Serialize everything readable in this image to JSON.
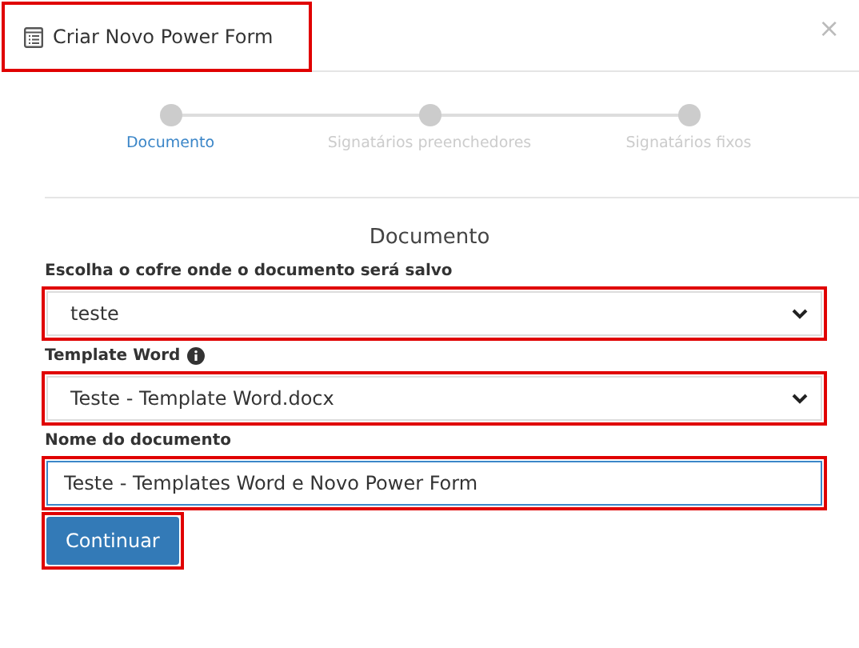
{
  "dialog": {
    "title": "Criar Novo Power Form",
    "title_highlighted": true,
    "close": "×"
  },
  "steps": [
    {
      "label": "Documento",
      "selected": true
    },
    {
      "label": "Signatários preenchedores",
      "selected": false
    },
    {
      "label": "Signatários fixos",
      "selected": false
    }
  ],
  "section_title": "Documento",
  "fields": [
    {
      "kind": "select",
      "label": "Escolha o cofre onde o documento será salvo",
      "info": false,
      "value": "teste",
      "highlighted": true
    },
    {
      "kind": "select",
      "label": "Template Word",
      "info": true,
      "value": "Teste - Template Word.docx",
      "highlighted": true
    },
    {
      "kind": "text",
      "label": "Nome do documento",
      "info": false,
      "value": "Teste - Templates Word e Novo Power Form",
      "highlighted": true,
      "focused": true
    }
  ],
  "button": {
    "label": "Continuar",
    "highlighted": true
  }
}
